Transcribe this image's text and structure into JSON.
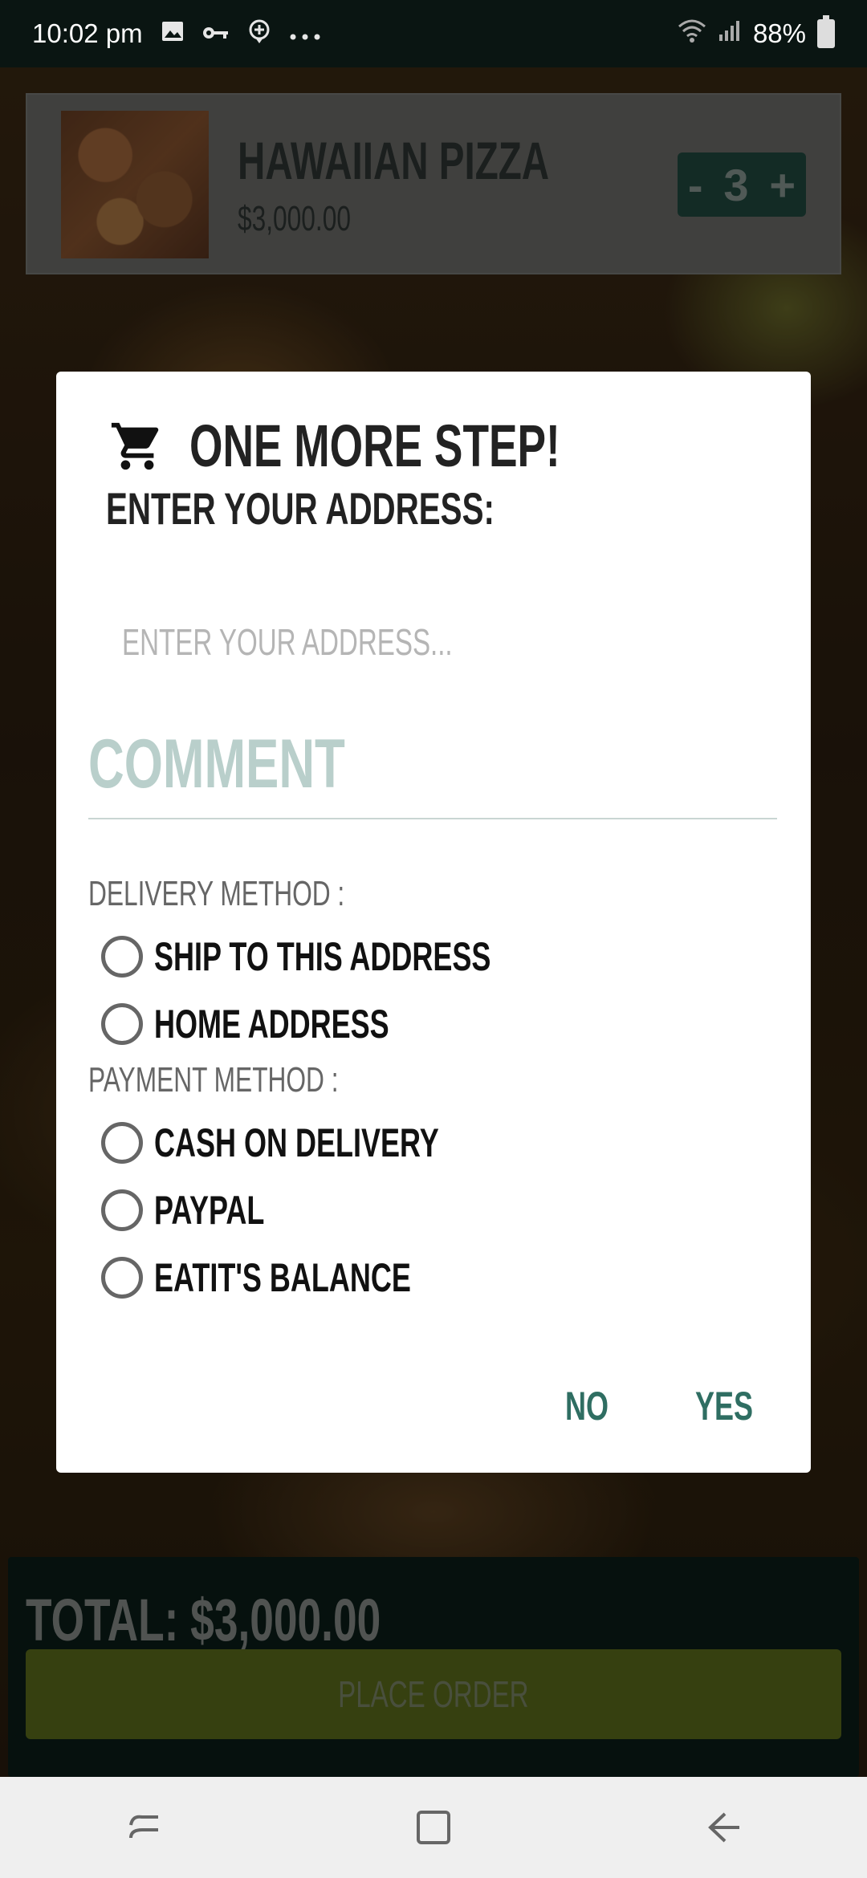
{
  "status_bar": {
    "time": "10:02 pm",
    "battery_text": "88%",
    "icons": [
      "image-icon",
      "key-icon",
      "location-plus-icon",
      "more-dots-icon",
      "wifi-icon",
      "signal-icon",
      "battery-icon"
    ]
  },
  "cart_item": {
    "name": "HAWAIIAN PIZZA",
    "price": "$3,000.00",
    "quantity": "3",
    "minus": "-",
    "plus": "+"
  },
  "dialog": {
    "title": "ONE MORE STEP!",
    "subtitle": "ENTER YOUR ADDRESS:",
    "address_placeholder": "ENTER YOUR ADDRESS...",
    "address_value": "",
    "comment_label": "COMMENT",
    "delivery_label": "DELIVERY METHOD :",
    "delivery_options": [
      "SHIP TO THIS ADDRESS",
      "HOME ADDRESS"
    ],
    "payment_label": "PAYMENT METHOD :",
    "payment_options": [
      "CASH ON DELIVERY",
      "PAYPAL",
      "EATIT'S BALANCE"
    ],
    "no_label": "NO",
    "yes_label": "YES"
  },
  "footer": {
    "total": "TOTAL: $3,000.00",
    "place_order": "PLACE ORDER"
  },
  "colors": {
    "accent": "#2f6e62",
    "stepper_bg": "#214a40",
    "place_order_bg": "#5d6f1d",
    "comment_hint": "#b9cfcb"
  }
}
